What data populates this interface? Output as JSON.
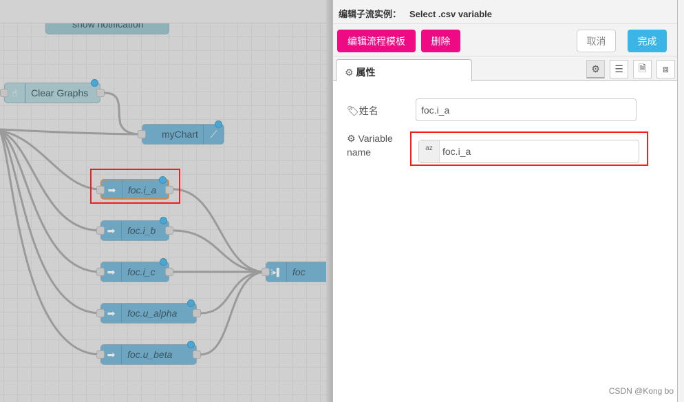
{
  "canvas": {
    "nodes": [
      {
        "label": "show notification",
        "icon": "notification-icon"
      },
      {
        "label": "Clear Graphs",
        "icon": "hand-pointer-icon"
      },
      {
        "label": "myChart",
        "icon": "line-chart-icon"
      },
      {
        "label": "foc.i_a",
        "icon": "arrow-right-icon",
        "selected": true
      },
      {
        "label": "foc.i_b",
        "icon": "arrow-right-icon"
      },
      {
        "label": "foc.i_c",
        "icon": "arrow-right-icon"
      },
      {
        "label": "foc.u_alpha",
        "icon": "arrow-right-icon"
      },
      {
        "label": "foc.u_beta",
        "icon": "arrow-right-icon"
      },
      {
        "label": "foc",
        "icon": "join-icon"
      }
    ]
  },
  "panel": {
    "title_prefix": "编辑子流实例：",
    "title": "Select .csv variable",
    "buttons": {
      "edit_template": "编辑流程模板",
      "delete": "删除",
      "cancel": "取消",
      "done": "完成"
    },
    "tab": "属性",
    "tab_icons": [
      "gear-icon",
      "list-icon",
      "document-icon",
      "frame-icon"
    ],
    "fields": {
      "name_label": "姓名",
      "name_value": "foc.i_a",
      "var_label_1": "Variable",
      "var_label_2": "name",
      "var_type": "az",
      "var_value": "foc.i_a"
    },
    "colors": {
      "danger": "#ee0a83",
      "primary": "#3ab5e6",
      "highlight": "#ff1a1a"
    }
  },
  "watermark": "CSDN @Kong bo"
}
